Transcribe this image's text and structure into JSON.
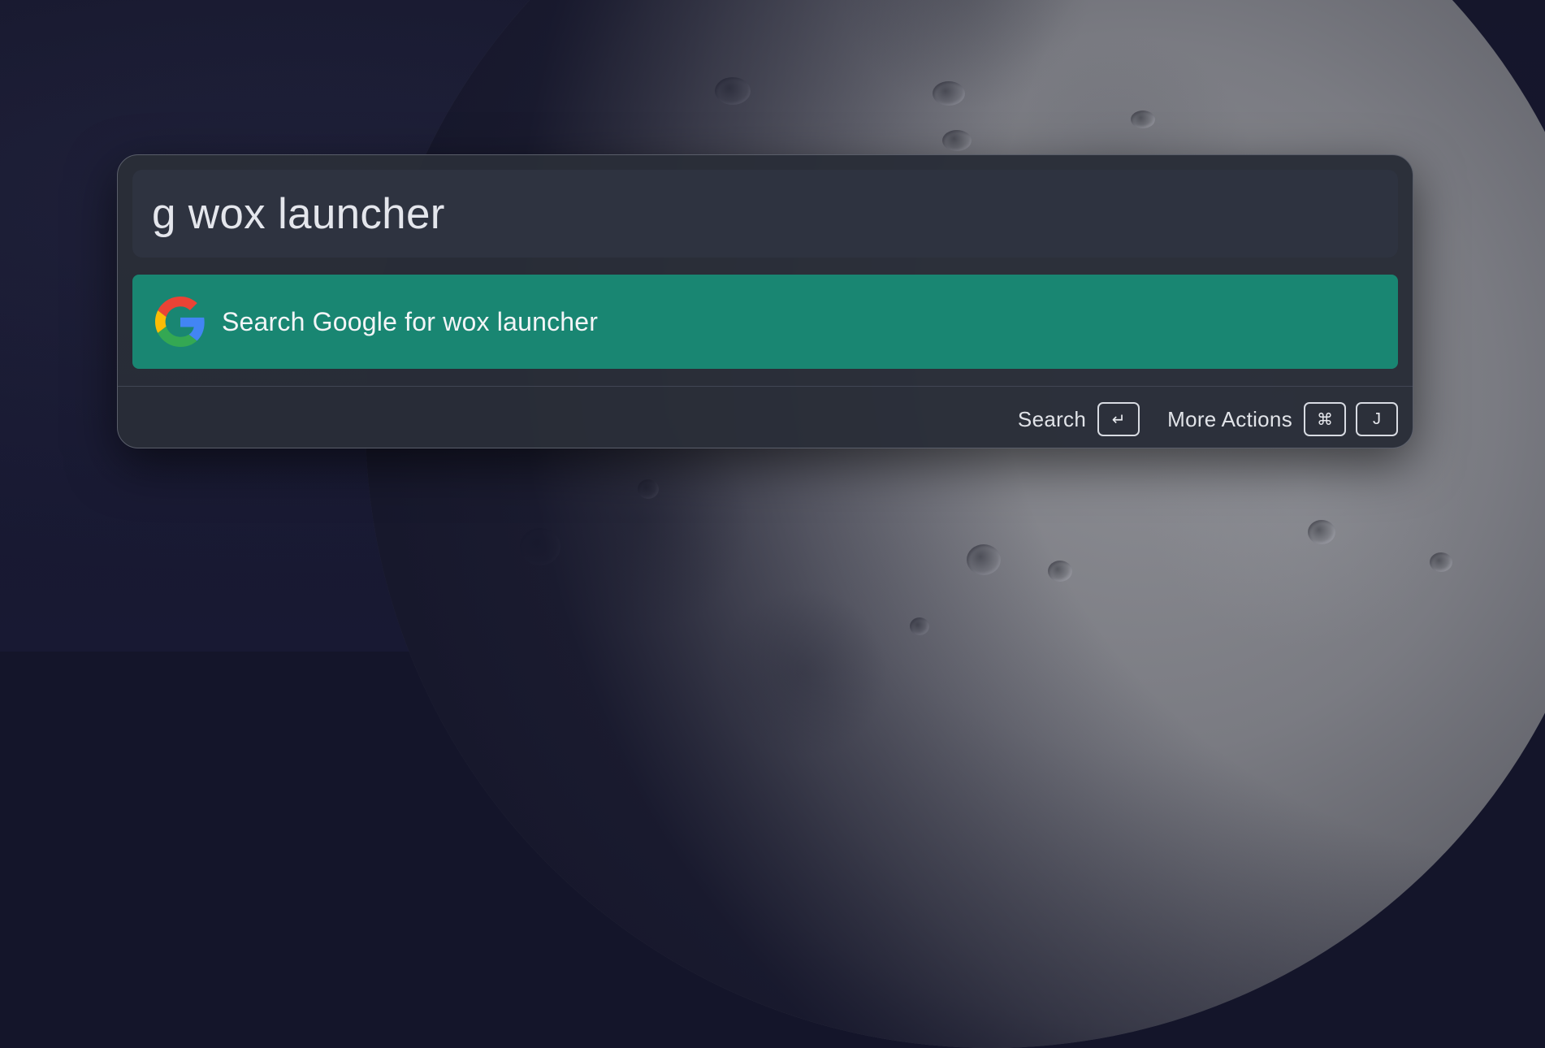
{
  "launcher": {
    "query": "g wox launcher",
    "results": [
      {
        "title": "Search Google for wox launcher",
        "icon": "google-g-icon",
        "selected": true
      }
    ],
    "footer": {
      "primary_action_label": "Search",
      "primary_action_key": "↵",
      "more_actions_label": "More Actions",
      "more_actions_keys": [
        "⌘",
        "J"
      ]
    }
  },
  "colors": {
    "panel_bg": "#292d38",
    "query_bg": "#2e3340",
    "selected_result_bg": "#198672",
    "text": "#e4e6ec",
    "google_blue": "#4285F4",
    "google_red": "#EA4335",
    "google_yellow": "#FBBC05",
    "google_green": "#34A853"
  }
}
